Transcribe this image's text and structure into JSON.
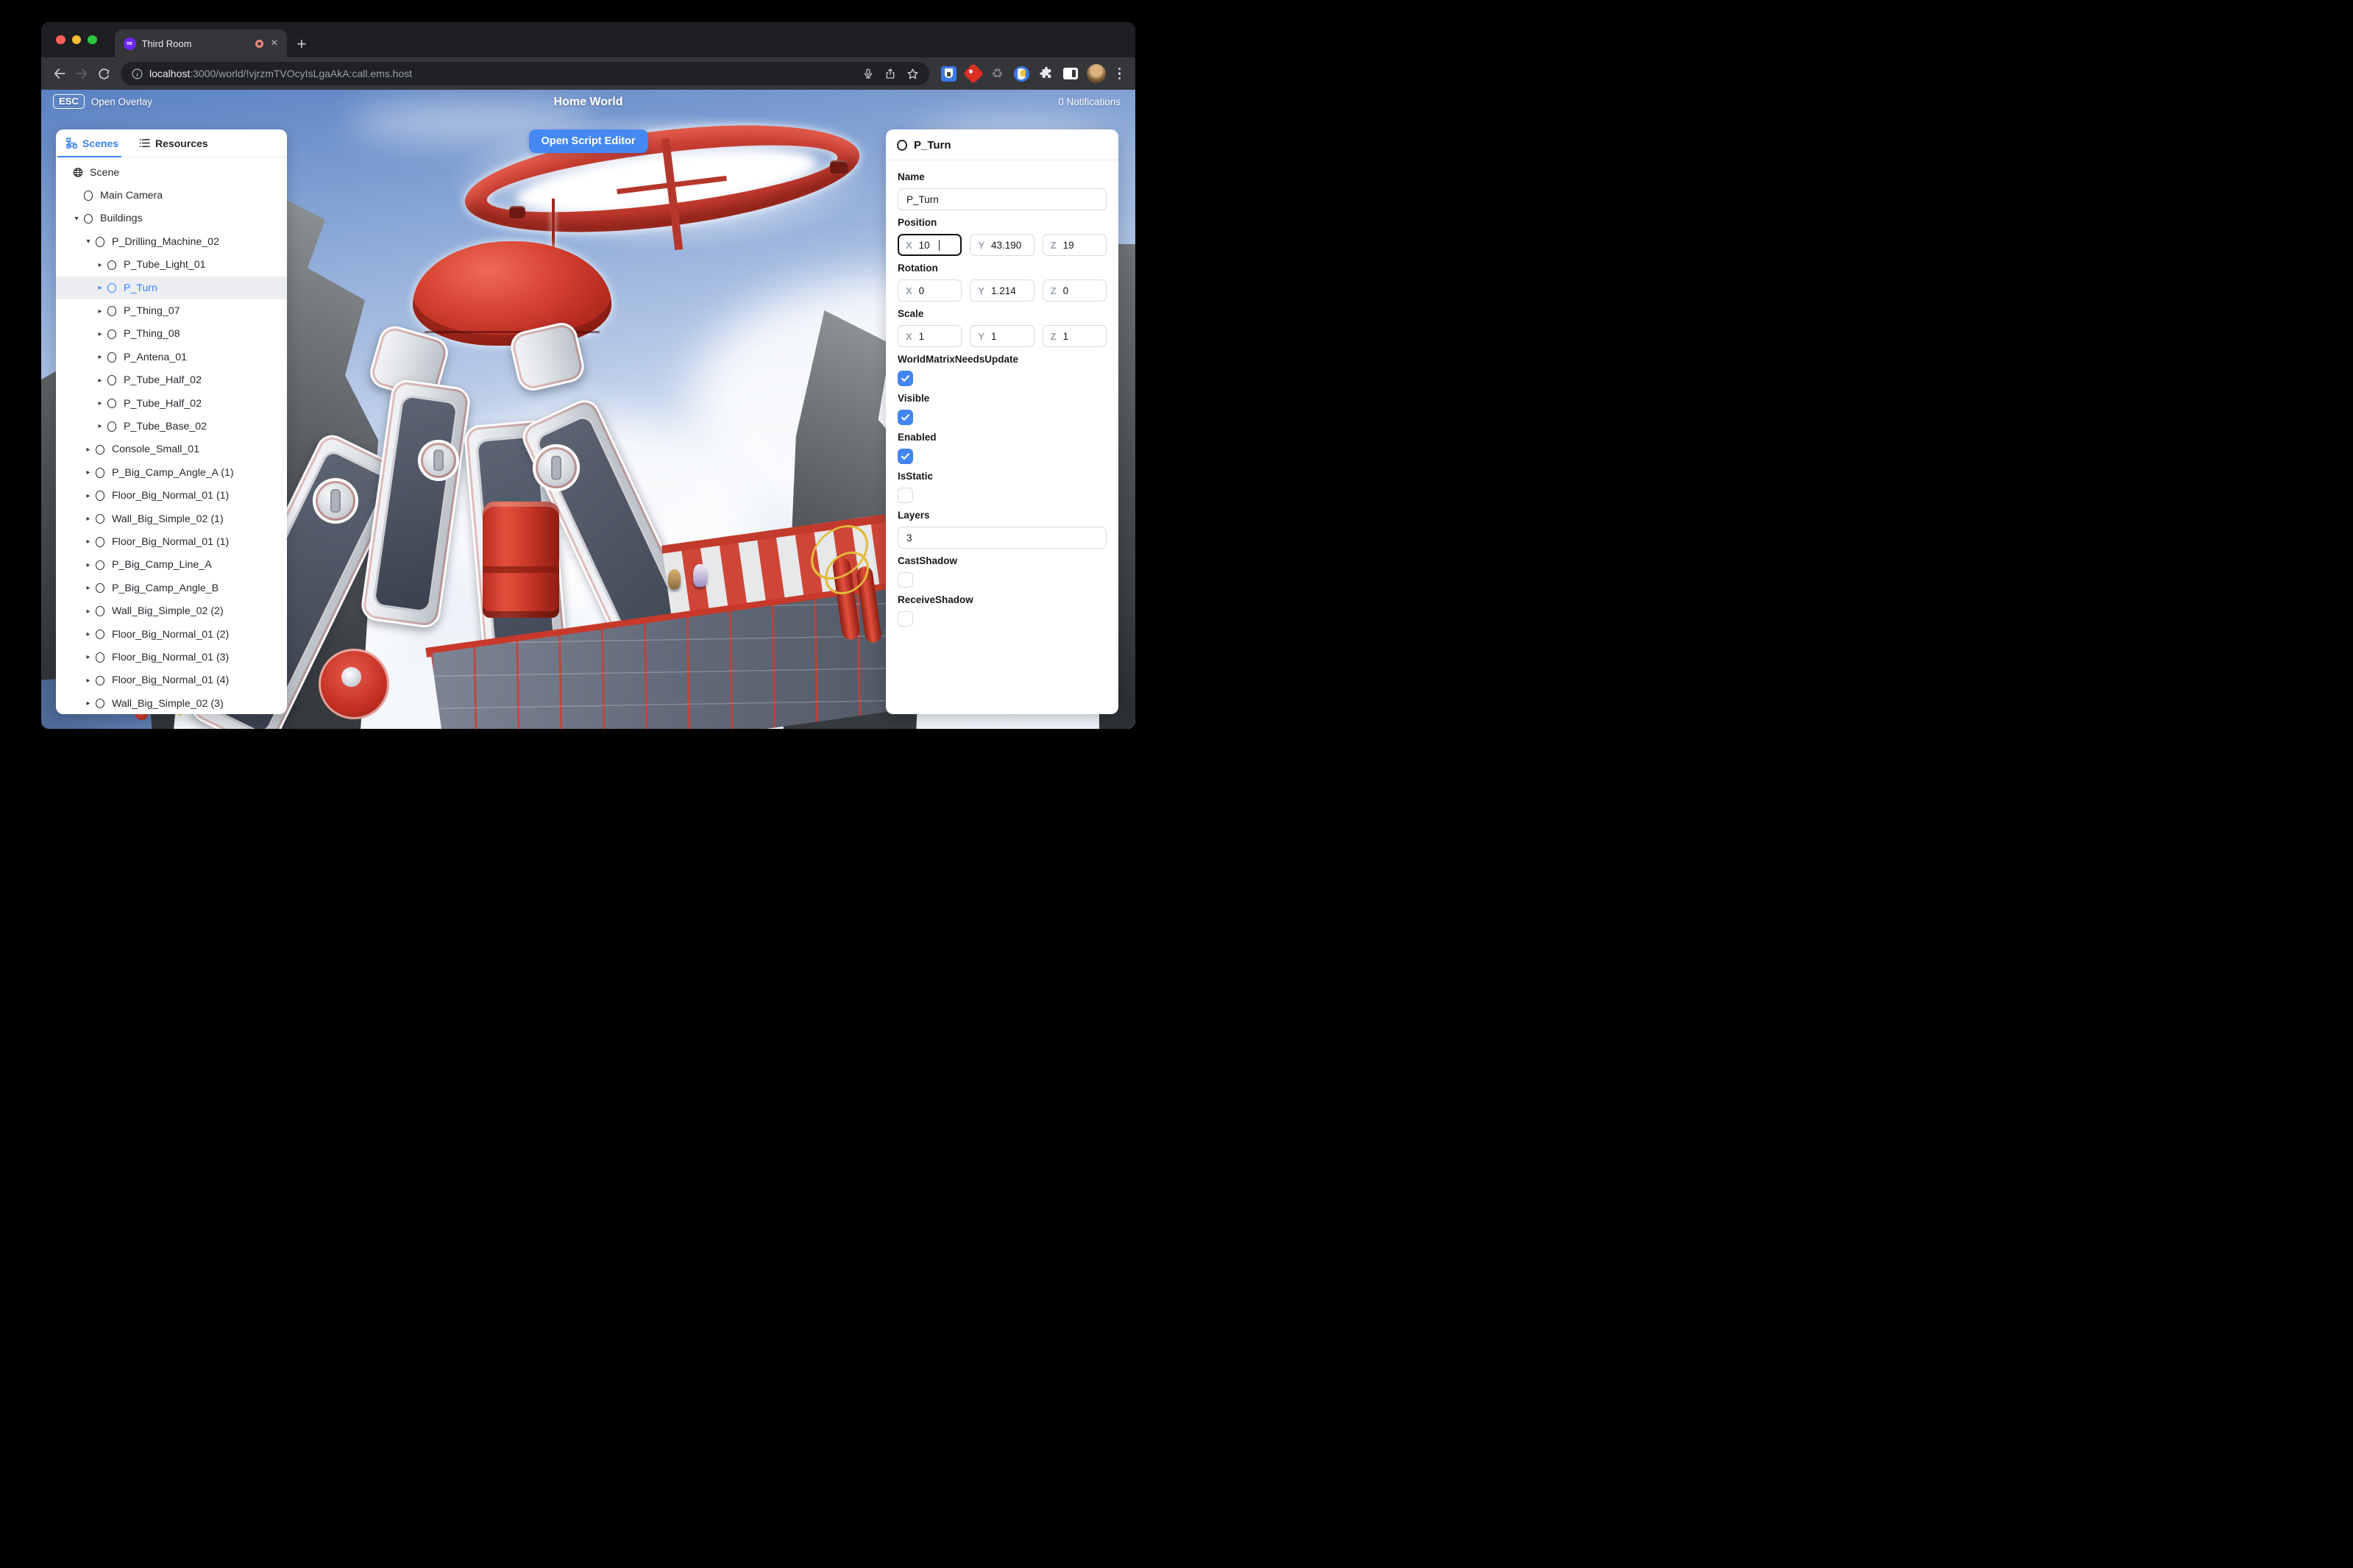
{
  "browser": {
    "tab": {
      "title": "Third Room",
      "favicon_glyph": "∞",
      "close_label": "×"
    },
    "new_tab_label": "+",
    "omnibox": {
      "url_host": "localhost",
      "url_rest": ":3000/world/!vjrzmTVOcyIsLgaAkA:call.ems.host"
    }
  },
  "overlay": {
    "esc_key": "ESC",
    "open_overlay_label": "Open Overlay",
    "world_title": "Home World",
    "notifications_label": "0 Notifications",
    "open_script_editor_label": "Open Script Editor"
  },
  "scene_panel": {
    "tabs": [
      {
        "label": "Scenes",
        "icon": "hierarchy-icon",
        "active": true
      },
      {
        "label": "Resources",
        "icon": "list-icon",
        "active": false
      }
    ],
    "tree": [
      {
        "label": "Scene",
        "level": 0,
        "chevron": "none",
        "icon": "globe",
        "selected": false
      },
      {
        "label": "Main Camera",
        "level": 1,
        "chevron": "none",
        "icon": "circle",
        "selected": false
      },
      {
        "label": "Buildings",
        "level": 1,
        "chevron": "down",
        "icon": "circle",
        "selected": false
      },
      {
        "label": "P_Drilling_Machine_02",
        "level": 2,
        "chevron": "down",
        "icon": "circle",
        "selected": false
      },
      {
        "label": "P_Tube_Light_01",
        "level": 3,
        "chevron": "right",
        "icon": "circle",
        "selected": false
      },
      {
        "label": "P_Turn",
        "level": 3,
        "chevron": "right",
        "icon": "circle",
        "selected": true
      },
      {
        "label": "P_Thing_07",
        "level": 3,
        "chevron": "right",
        "icon": "circle",
        "selected": false
      },
      {
        "label": "P_Thing_08",
        "level": 3,
        "chevron": "right",
        "icon": "circle",
        "selected": false
      },
      {
        "label": "P_Antena_01",
        "level": 3,
        "chevron": "right",
        "icon": "circle",
        "selected": false
      },
      {
        "label": "P_Tube_Half_02",
        "level": 3,
        "chevron": "right",
        "icon": "circle",
        "selected": false
      },
      {
        "label": "P_Tube_Half_02",
        "level": 3,
        "chevron": "right",
        "icon": "circle",
        "selected": false
      },
      {
        "label": "P_Tube_Base_02",
        "level": 3,
        "chevron": "right",
        "icon": "circle",
        "selected": false
      },
      {
        "label": "Console_Small_01",
        "level": 2,
        "chevron": "right",
        "icon": "circle",
        "selected": false
      },
      {
        "label": "P_Big_Camp_Angle_A (1)",
        "level": 2,
        "chevron": "right",
        "icon": "circle",
        "selected": false
      },
      {
        "label": "Floor_Big_Normal_01 (1)",
        "level": 2,
        "chevron": "right",
        "icon": "circle",
        "selected": false
      },
      {
        "label": "Wall_Big_Simple_02 (1)",
        "level": 2,
        "chevron": "right",
        "icon": "circle",
        "selected": false
      },
      {
        "label": "Floor_Big_Normal_01 (1)",
        "level": 2,
        "chevron": "right",
        "icon": "circle",
        "selected": false
      },
      {
        "label": "P_Big_Camp_Line_A",
        "level": 2,
        "chevron": "right",
        "icon": "circle",
        "selected": false
      },
      {
        "label": "P_Big_Camp_Angle_B",
        "level": 2,
        "chevron": "right",
        "icon": "circle",
        "selected": false
      },
      {
        "label": "Wall_Big_Simple_02 (2)",
        "level": 2,
        "chevron": "right",
        "icon": "circle",
        "selected": false
      },
      {
        "label": "Floor_Big_Normal_01 (2)",
        "level": 2,
        "chevron": "right",
        "icon": "circle",
        "selected": false
      },
      {
        "label": "Floor_Big_Normal_01 (3)",
        "level": 2,
        "chevron": "right",
        "icon": "circle",
        "selected": false
      },
      {
        "label": "Floor_Big_Normal_01 (4)",
        "level": 2,
        "chevron": "right",
        "icon": "circle",
        "selected": false
      },
      {
        "label": "Wall_Big_Simple_02 (3)",
        "level": 2,
        "chevron": "right",
        "icon": "circle",
        "selected": false
      }
    ]
  },
  "inspector": {
    "header_title": "P_Turn",
    "axes": [
      "X",
      "Y",
      "Z"
    ],
    "fields": {
      "name": {
        "label": "Name",
        "value": "P_Turn"
      },
      "position": {
        "label": "Position",
        "x": "10",
        "y": "43.190",
        "z": "19"
      },
      "rotation": {
        "label": "Rotation",
        "x": "0",
        "y": "1.214",
        "z": "0"
      },
      "scale": {
        "label": "Scale",
        "x": "1",
        "y": "1",
        "z": "1"
      },
      "world_matrix": {
        "label": "WorldMatrixNeedsUpdate",
        "checked": true
      },
      "visible": {
        "label": "Visible",
        "checked": true
      },
      "enabled": {
        "label": "Enabled",
        "checked": true
      },
      "is_static": {
        "label": "IsStatic",
        "checked": false
      },
      "layers": {
        "label": "Layers",
        "value": "3"
      },
      "cast_shadow": {
        "label": "CastShadow",
        "checked": false
      },
      "receive_shadow": {
        "label": "ReceiveShadow",
        "checked": false
      }
    }
  },
  "colors": {
    "accent": "#3b82f6",
    "button": "#4688f1",
    "checkbox": "#4285f4",
    "selection_red": "#c0392e"
  }
}
